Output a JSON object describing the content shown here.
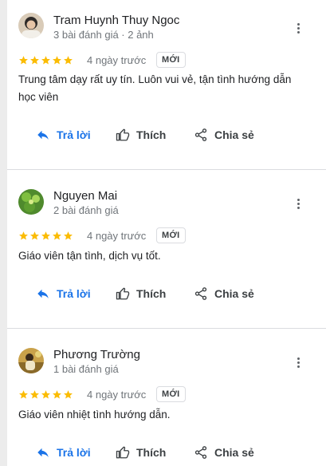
{
  "reviews": [
    {
      "name": "Tram Huynh Thuy Ngoc",
      "meta": "3 bài đánh giá · 2 ảnh",
      "rating": 5,
      "date": "4 ngày trước",
      "badge": "MỚI",
      "text": "Trung tâm dạy rất uy tín. Luôn vui vẻ, tận tình hướng dẫn học viên",
      "actions": {
        "reply": "Trả lời",
        "like": "Thích",
        "share": "Chia sẻ"
      }
    },
    {
      "name": "Nguyen Mai",
      "meta": "2 bài đánh giá",
      "rating": 5,
      "date": "4 ngày trước",
      "badge": "MỚI",
      "text": "Giáo viên tận tình, dịch vụ tốt.",
      "actions": {
        "reply": "Trả lời",
        "like": "Thích",
        "share": "Chia sẻ"
      }
    },
    {
      "name": "Phương Trường",
      "meta": "1 bài đánh giá",
      "rating": 5,
      "date": "4 ngày trước",
      "badge": "MỚI",
      "text": "Giáo viên nhiệt tình hướng dẫn.",
      "actions": {
        "reply": "Trả lời",
        "like": "Thích",
        "share": "Chia sẻ"
      }
    }
  ],
  "colors": {
    "star": "#fbbc04",
    "reply": "#1a73e8",
    "text": "#202124",
    "muted": "#70757a"
  }
}
